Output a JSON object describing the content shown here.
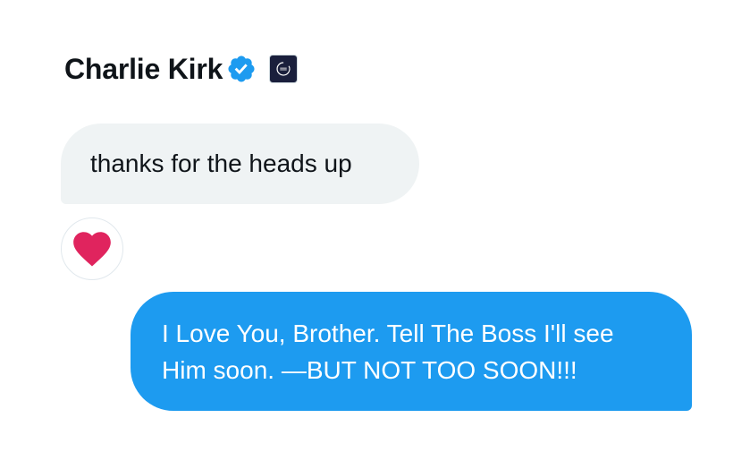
{
  "conversation": {
    "sender_name": "Charlie Kirk",
    "verified_icon": "verified-badge-icon",
    "affiliate_icon": "organization-affiliate-badge-icon"
  },
  "messages": [
    {
      "direction": "received",
      "text": "thanks for the heads up",
      "reaction": "heart-icon"
    },
    {
      "direction": "sent",
      "text": "I Love You, Brother. Tell The Boss I'll see\nHim soon. —BUT NOT TOO SOON!!!"
    }
  ],
  "colors": {
    "sent_bubble": "#1d9bf0",
    "received_bubble": "#eff3f4",
    "verified": "#1d9bf0",
    "heart": "#e0245e",
    "name_text": "#0f1419"
  }
}
